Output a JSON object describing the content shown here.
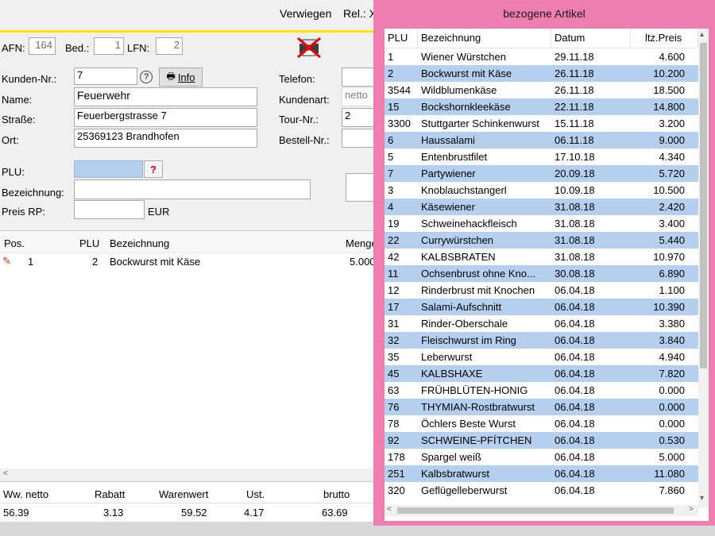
{
  "toolbar": {
    "title_left": "Verwiegen",
    "title_right": "Rel.: X"
  },
  "header": {
    "afn_label": "AFN:",
    "afn_value": "164",
    "bed_label": "Bed.:",
    "bed_value": "1",
    "lfn_label": "LFN:",
    "lfn_value": "2"
  },
  "customer": {
    "kunden_nr_label": "Kunden-Nr.:",
    "kunden_nr_value": "7",
    "info_button": "Info",
    "name_label": "Name:",
    "name_value": "Feuerwehr",
    "strasse_label": "Straße:",
    "strasse_value": "Feuerbergstrasse 7",
    "ort_label": "Ort:",
    "ort_value": "25369123 Brandhofen",
    "telefon_label": "Telefon:",
    "kundenart_label": "Kundenart:",
    "kundenart_value": "netto",
    "tour_label": "Tour-Nr.:",
    "tour_value": "2",
    "bestell_label": "Bestell-Nr.:"
  },
  "article": {
    "plu_label": "PLU:",
    "bezeichnung_label": "Bezeichnung:",
    "preis_label": "Preis RP:",
    "currency": "EUR"
  },
  "positions": {
    "columns": [
      "Pos.",
      "PLU",
      "Bezeichnung",
      "Menge"
    ],
    "rows": [
      {
        "pos": "1",
        "plu": "2",
        "bez": "Bockwurst mit Käse",
        "menge": "5.000"
      }
    ]
  },
  "totals": {
    "labels": [
      "Ww. netto",
      "Rabatt",
      "Warenwert",
      "Ust.",
      "brutto"
    ],
    "values": [
      "56.39",
      "3.13",
      "59.52",
      "4.17",
      "63.69"
    ]
  },
  "popup": {
    "title": "bezogene Artikel",
    "columns": [
      "PLU",
      "Bezeichnung",
      "Datum",
      "ltz.Preis"
    ],
    "rows": [
      {
        "plu": "1",
        "bez": "Wiener Würstchen",
        "datum": "29.11.18",
        "preis": "4.600"
      },
      {
        "plu": "2",
        "bez": "Bockwurst mit Käse",
        "datum": "26.11.18",
        "preis": "10.200"
      },
      {
        "plu": "3544",
        "bez": "Wildblumenkäse",
        "datum": "26.11.18",
        "preis": "18.500"
      },
      {
        "plu": "15",
        "bez": "Bockshornkleekäse",
        "datum": "22.11.18",
        "preis": "14.800"
      },
      {
        "plu": "3300",
        "bez": "Stuttgarter Schinkenwurst",
        "datum": "15.11.18",
        "preis": "3.200"
      },
      {
        "plu": "6",
        "bez": "Haussalami",
        "datum": "06.11.18",
        "preis": "9.000"
      },
      {
        "plu": "5",
        "bez": "Entenbrustfilet",
        "datum": "17.10.18",
        "preis": "4.340"
      },
      {
        "plu": "7",
        "bez": "Partywiener",
        "datum": "20.09.18",
        "preis": "5.720"
      },
      {
        "plu": "3",
        "bez": "Knoblauchstangerl",
        "datum": "10.09.18",
        "preis": "10.500"
      },
      {
        "plu": "4",
        "bez": "Käsewiener",
        "datum": "31.08.18",
        "preis": "2.420"
      },
      {
        "plu": "19",
        "bez": "Schweinehackfleisch",
        "datum": "31.08.18",
        "preis": "3.400"
      },
      {
        "plu": "22",
        "bez": "Currywürstchen",
        "datum": "31.08.18",
        "preis": "5.440"
      },
      {
        "plu": "42",
        "bez": "KALBSBRATEN",
        "datum": "31.08.18",
        "preis": "10.970"
      },
      {
        "plu": "11",
        "bez": "Ochsenbrust ohne Kno...",
        "datum": "30.08.18",
        "preis": "6.890"
      },
      {
        "plu": "12",
        "bez": "Rinderbrust mit Knochen",
        "datum": "06.04.18",
        "preis": "1.100"
      },
      {
        "plu": "17",
        "bez": "Salami-Aufschnitt",
        "datum": "06.04.18",
        "preis": "10.390"
      },
      {
        "plu": "31",
        "bez": "Rinder-Oberschale",
        "datum": "06.04.18",
        "preis": "3.380"
      },
      {
        "plu": "32",
        "bez": "Fleischwurst im Ring",
        "datum": "06.04.18",
        "preis": "3.840"
      },
      {
        "plu": "35",
        "bez": "Leberwurst",
        "datum": "06.04.18",
        "preis": "4.940"
      },
      {
        "plu": "45",
        "bez": "KALBSHAXE",
        "datum": "06.04.18",
        "preis": "7.820"
      },
      {
        "plu": "63",
        "bez": "FRÜHBLÜTEN-HONIG",
        "datum": "06.04.18",
        "preis": "0.000"
      },
      {
        "plu": "76",
        "bez": "THYMIAN-Rostbratwurst",
        "datum": "06.04.18",
        "preis": "0.000"
      },
      {
        "plu": "78",
        "bez": "Öchlers Beste Wurst",
        "datum": "06.04.18",
        "preis": "0.000"
      },
      {
        "plu": "92",
        "bez": "SCHWEINE-PFÍTCHEN",
        "datum": "06.04.18",
        "preis": "0.530"
      },
      {
        "plu": "178",
        "bez": "Spargel  weiß",
        "datum": "06.04.18",
        "preis": "5.000"
      },
      {
        "plu": "251",
        "bez": "Kalbsbratwurst",
        "datum": "06.04.18",
        "preis": "11.080"
      },
      {
        "plu": "320",
        "bez": "Geflügelleberwurst",
        "datum": "06.04.18",
        "preis": "7.860"
      }
    ]
  },
  "colors": {
    "popup_border": "#ee7db0",
    "row_highlight": "#b5d0ef",
    "accent_line": "#ffe600"
  }
}
